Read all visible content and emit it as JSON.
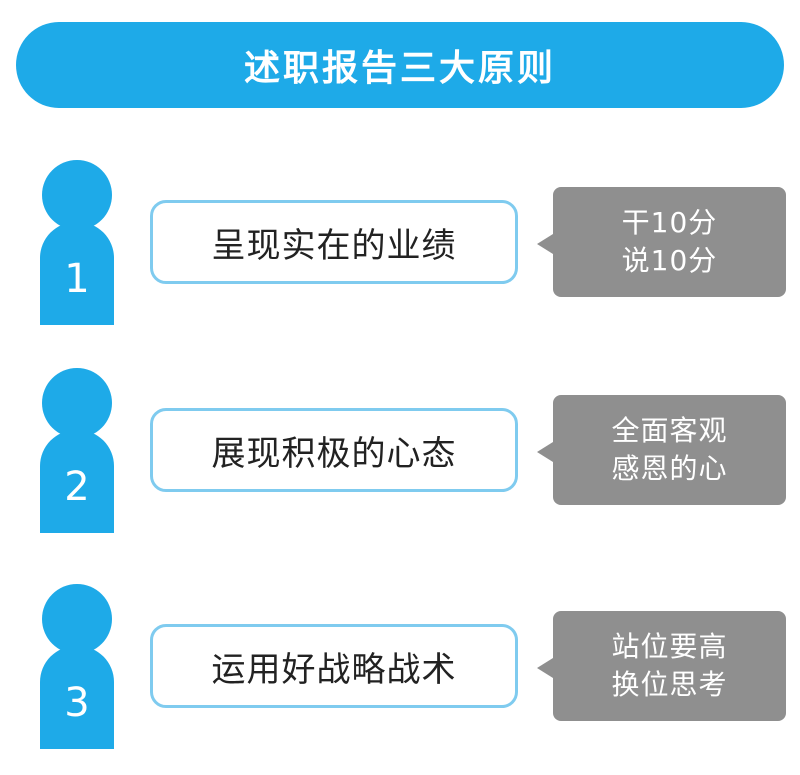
{
  "header": {
    "title": "述职报告三大原则"
  },
  "principles": [
    {
      "number": "1",
      "text": "呈现实在的业绩",
      "note": [
        "干10分",
        "说10分"
      ]
    },
    {
      "number": "2",
      "text": "展现积极的心态",
      "note": [
        "全面客观",
        "感恩的心"
      ]
    },
    {
      "number": "3",
      "text": "运用好战略战术",
      "note": [
        "站位要高",
        "换位思考"
      ]
    }
  ],
  "colors": {
    "accent": "#1eaae8",
    "box_border": "#7fcbef",
    "note_bg": "#8f8f8f"
  },
  "icons": {
    "person": "person-icon"
  }
}
